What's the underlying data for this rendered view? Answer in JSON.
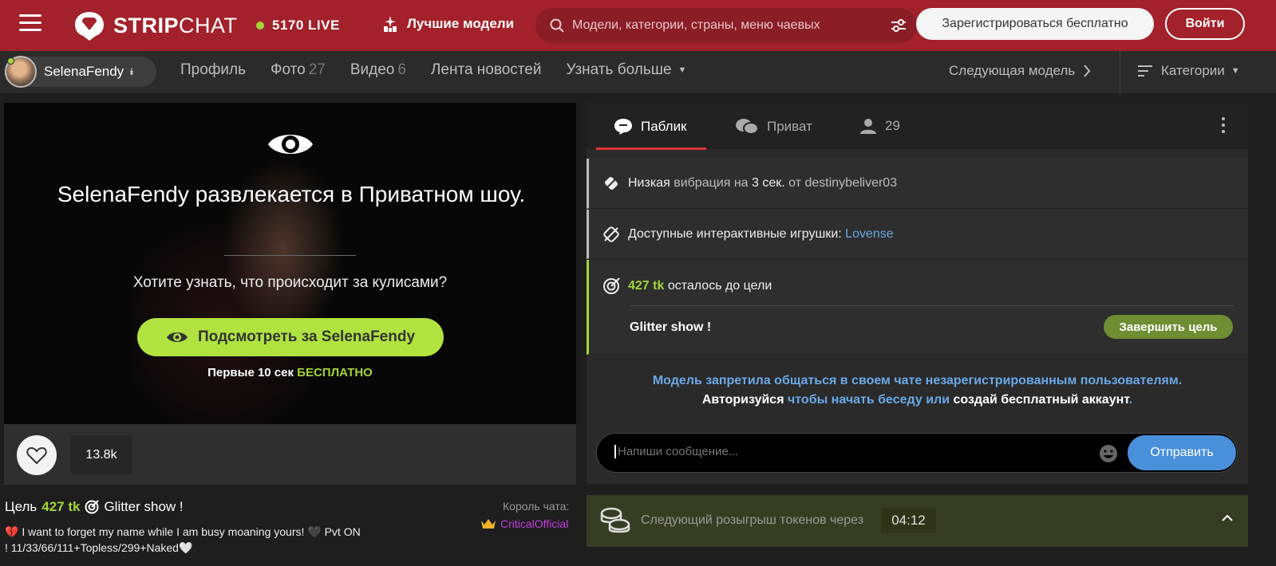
{
  "header": {
    "logo_bold": "STRIP",
    "logo_light": "CHAT",
    "live_text": "5170 LIVE",
    "best_models": "Лучшие модели",
    "search_placeholder": "Модели, категории, страны, меню чаевых",
    "register_label": "Зарегистрироваться бесплатно",
    "login_label": "Войти",
    "colors": {
      "brand": "#a3212b",
      "live_dot": "#a3d53a"
    }
  },
  "model_nav": {
    "model_name": "SelenaFendy",
    "links": [
      {
        "label": "Профиль",
        "count": ""
      },
      {
        "label": "Фото",
        "count": "27"
      },
      {
        "label": "Видео",
        "count": "6"
      },
      {
        "label": "Лента новостей",
        "count": ""
      },
      {
        "label": "Узнать больше",
        "count": ""
      }
    ],
    "next_model": "Следующая модель",
    "categories": "Категории"
  },
  "player": {
    "private_message": "SelenaFendy развлекается в Приватном шоу.",
    "question": "Хотите узнать, что происходит за кулисами?",
    "peek_button": "Подсмотреть за SelenaFendy",
    "free_prefix": "Первые 10 сек",
    "free_highlight": "БЕСПЛАТНО",
    "likes": "13.8k"
  },
  "below_player": {
    "goal_prefix": "Цель",
    "goal_tokens": "427 tk",
    "goal_name": "Glitter show !",
    "description_line1": "💔 I want to forget my name while I am busy moaning yours! 🖤 Pvt ON",
    "description_line2": "! 11/33/66/111+Topless/299+Naked🤍",
    "king_label": "Король чата:",
    "king_name": "CriticalOfficial"
  },
  "chat": {
    "tabs": [
      {
        "label": "Паблик",
        "icon": "chat-bubble-icon",
        "active": true
      },
      {
        "label": "Приват",
        "icon": "private-chat-icon",
        "active": false
      },
      {
        "label": "29",
        "icon": "user-icon",
        "active": false
      }
    ],
    "events": {
      "vibration": {
        "w1": "Низкая",
        "w2": "вибрация на",
        "w3": "3 сек.",
        "w4": "от",
        "user": "destinybeliver03"
      },
      "toys": {
        "text": "Доступные интерактивные игрушки:",
        "toy": "Lovense"
      },
      "goal": {
        "tokens": "427 tk",
        "rest": "осталось до цели",
        "title": "Glitter show !",
        "button": "Завершить цель"
      }
    },
    "notice_line1": "Модель запретила общаться в своем чате незарегистрированным пользователям.",
    "notice_line2_a": "Авторизуйся",
    "notice_line2_b": "чтобы начать беседу или",
    "notice_line2_c": "создай бесплатный аккаунт",
    "notice_line2_d": ".",
    "input_placeholder": "Напиши сообщение...",
    "send_label": "Отправить"
  },
  "giveaway": {
    "text": "Следующий розыгрыш токенов через",
    "timer": "04:12"
  }
}
